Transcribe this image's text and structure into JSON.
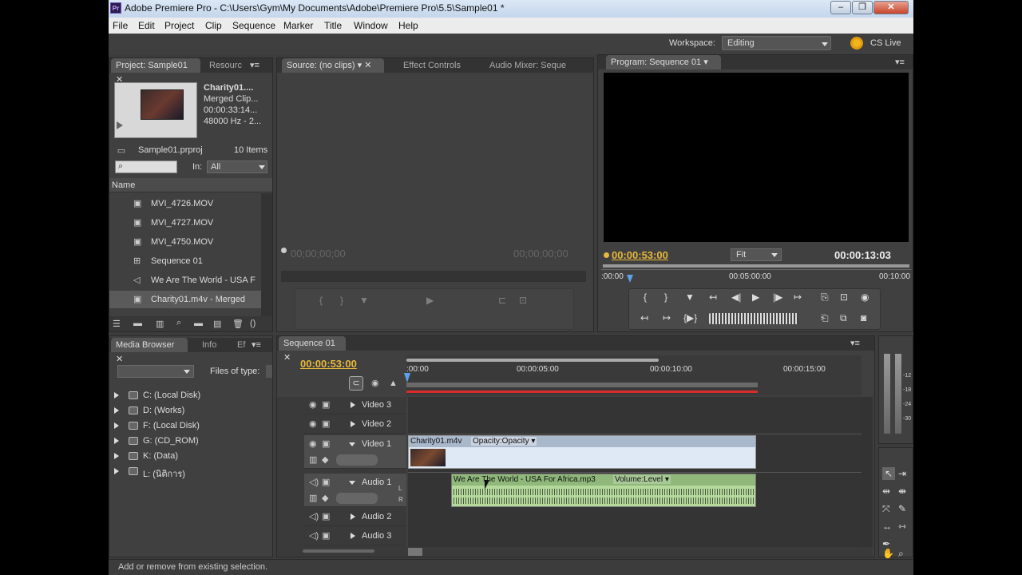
{
  "window": {
    "title": "Adobe Premiere Pro - C:\\Users\\Gym\\My Documents\\Adobe\\Premiere Pro\\5.5\\Sample01 *",
    "app_icon": "Pr"
  },
  "menu": [
    "File",
    "Edit",
    "Project",
    "Clip",
    "Sequence",
    "Marker",
    "Title",
    "Window",
    "Help"
  ],
  "workspace": {
    "label": "Workspace:",
    "value": "Editing",
    "cs_live": "CS Live"
  },
  "project_panel": {
    "tabs": [
      "Project: Sample01",
      "Resourc"
    ],
    "preview": {
      "name": "Charity01....",
      "type": "Merged Clip...",
      "duration": "00:00:33:14...",
      "audio": "48000 Hz - 2..."
    },
    "project_file": "Sample01.prproj",
    "item_count": "10 Items",
    "search_placeholder": "",
    "in_label": "In:",
    "in_value": "All",
    "column_name": "Name",
    "items": [
      "MVI_4726.MOV",
      "MVI_4727.MOV",
      "MVI_4750.MOV",
      "Sequence 01",
      "We Are The World - USA F",
      "Charity01.m4v - Merged"
    ]
  },
  "source_panel": {
    "tabs": [
      "Source: (no clips)",
      "Effect Controls",
      "Audio Mixer: Seque"
    ],
    "timecode_in": "00;00;00;00",
    "timecode_out": "00;00;00;00"
  },
  "program_panel": {
    "tab": "Program: Sequence 01",
    "timecode": "00:00:53:00",
    "fit": "Fit",
    "duration": "00:00:13:03",
    "ruler": [
      ":00:00",
      "00:05:00:00",
      "00:10:00"
    ]
  },
  "media_browser": {
    "tabs": [
      "Media Browser",
      "Info",
      "Ef"
    ],
    "files_of_type": "Files of type:",
    "drives": [
      "C: (Local Disk)",
      "D: (Works)",
      "F: (Local Disk)",
      "G: (CD_ROM)",
      "K: (Data)",
      "L: (นิติการ)"
    ]
  },
  "sequence": {
    "tab": "Sequence 01",
    "timecode": "00:00:53:00",
    "ruler": [
      ":00:00",
      "00:00:05:00",
      "00:00:10:00",
      "00:00:15:00"
    ],
    "tracks": {
      "video3": "Video 3",
      "video2": "Video 2",
      "video1": "Video 1",
      "audio1": "Audio 1",
      "audio2": "Audio 2",
      "audio3": "Audio 3"
    },
    "video_clip": {
      "name": "Charity01.m4v",
      "effect": "Opacity:Opacity"
    },
    "audio_clip": {
      "name": "We Are The World - USA For Africa.mp3",
      "effect": "Volume:Level"
    },
    "lr": [
      "L",
      "R"
    ]
  },
  "meter_labels": [
    "-12",
    "-18",
    "-24",
    "-30"
  ],
  "status": "Add or remove from existing selection.",
  "colors": {
    "timecode": "#e8b83a",
    "accent": "#f2b51e",
    "video_clip": "#dfe8f5",
    "audio_clip": "#b5d99c"
  }
}
